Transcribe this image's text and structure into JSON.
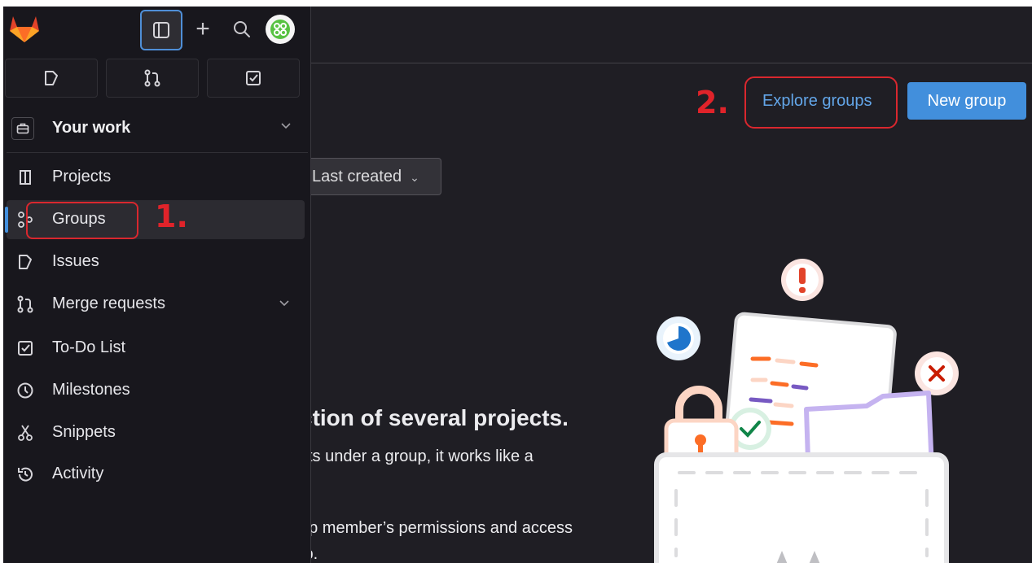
{
  "header": {
    "logo_icon": "gitlab-tanuki-icon",
    "sidebar_toggle_icon": "sidebar-toggle-icon",
    "plus_icon": "plus-icon",
    "search_icon": "search-icon",
    "avatar_icon": "user-avatar-icon"
  },
  "quick_actions": [
    {
      "name": "issues-shortcut",
      "icon": "issues-icon"
    },
    {
      "name": "merge-requests-shortcut",
      "icon": "merge-request-icon"
    },
    {
      "name": "todo-shortcut",
      "icon": "todo-icon"
    }
  ],
  "context": {
    "label": "Your work",
    "icon": "briefcase-icon"
  },
  "nav": {
    "projects": "Projects",
    "groups": "Groups",
    "issues": "Issues",
    "merge_requests": "Merge requests",
    "todo": "To-Do List",
    "milestones": "Milestones",
    "snippets": "Snippets",
    "activity": "Activity"
  },
  "main": {
    "explore_groups": "Explore groups",
    "new_group": "New group",
    "sort_label": "Last created",
    "empty_title": "ction of several projects.",
    "empty_p1": "cts under a group, it works like a",
    "empty_p2": "up member’s permissions and access",
    "empty_p3": "ıp."
  },
  "annotations": {
    "step1": "1.",
    "step2": "2."
  },
  "colors": {
    "accent": "#428fdc",
    "link": "#63a6e9",
    "annotation": "#e0232a",
    "background": "#1f1e24",
    "sidebar": "#18171d"
  }
}
